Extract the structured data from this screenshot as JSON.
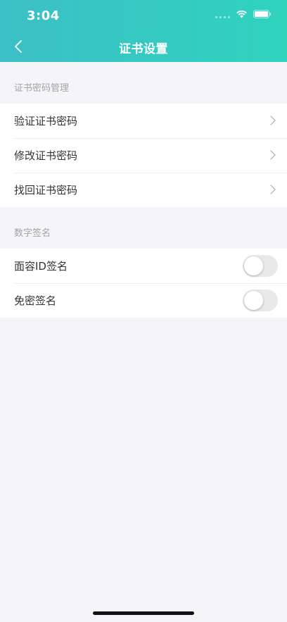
{
  "status_bar": {
    "time": "3:04"
  },
  "nav": {
    "title": "证书设置",
    "back_icon": "chevron-left-icon"
  },
  "sections": [
    {
      "label": "证书密码管理",
      "items": [
        {
          "label": "验证证书密码",
          "icon": "chevron-right-icon"
        },
        {
          "label": "修改证书密码",
          "icon": "chevron-right-icon"
        },
        {
          "label": "找回证书密码",
          "icon": "chevron-right-icon"
        }
      ]
    },
    {
      "label": "数字签名",
      "items": [
        {
          "label": "面容ID签名",
          "toggle_on": false
        },
        {
          "label": "免密签名",
          "toggle_on": false
        }
      ]
    }
  ],
  "colors": {
    "header_start": "#3cbfc7",
    "header_end": "#2fd3be",
    "background": "#f5f5f9"
  }
}
